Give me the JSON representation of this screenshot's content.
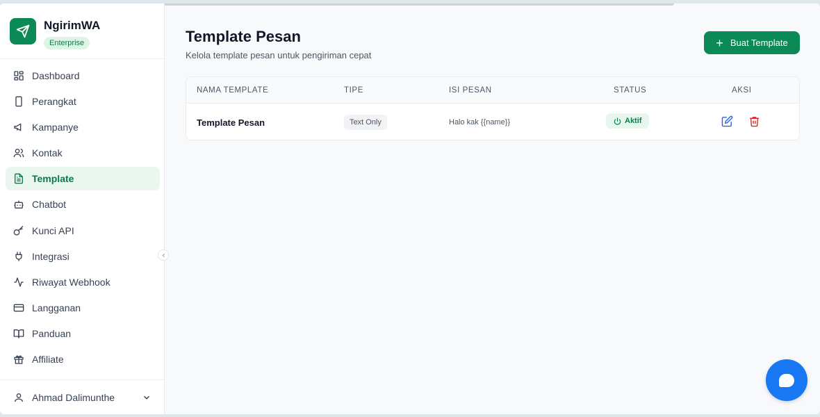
{
  "app": {
    "name": "NgirimWA",
    "plan": "Enterprise"
  },
  "sidebar": {
    "items": [
      {
        "label": "Dashboard",
        "icon": "dashboard-icon"
      },
      {
        "label": "Perangkat",
        "icon": "smartphone-icon"
      },
      {
        "label": "Kampanye",
        "icon": "megaphone-icon"
      },
      {
        "label": "Kontak",
        "icon": "users-icon"
      },
      {
        "label": "Template",
        "icon": "file-text-icon",
        "active": true
      },
      {
        "label": "Chatbot",
        "icon": "bot-icon"
      },
      {
        "label": "Kunci API",
        "icon": "key-icon"
      },
      {
        "label": "Integrasi",
        "icon": "plug-icon"
      },
      {
        "label": "Riwayat Webhook",
        "icon": "activity-icon"
      },
      {
        "label": "Langganan",
        "icon": "credit-card-icon"
      },
      {
        "label": "Panduan",
        "icon": "book-icon"
      },
      {
        "label": "Affiliate",
        "icon": "gift-icon"
      }
    ],
    "user": {
      "name": "Ahmad Dalimunthe"
    }
  },
  "header": {
    "title": "Template Pesan",
    "subtitle": "Kelola template pesan untuk pengiriman cepat",
    "create_button": "Buat Template"
  },
  "table": {
    "columns": [
      "NAMA TEMPLATE",
      "TIPE",
      "ISI PESAN",
      "STATUS",
      "AKSI"
    ],
    "rows": [
      {
        "name": "Template Pesan",
        "type": "Text Only",
        "message": "Halo kak {{name}}",
        "status": "Aktif"
      }
    ]
  },
  "colors": {
    "brand": "#0b8a55",
    "edit": "#2563eb",
    "delete": "#dc2626",
    "fab": "#1877f2"
  }
}
